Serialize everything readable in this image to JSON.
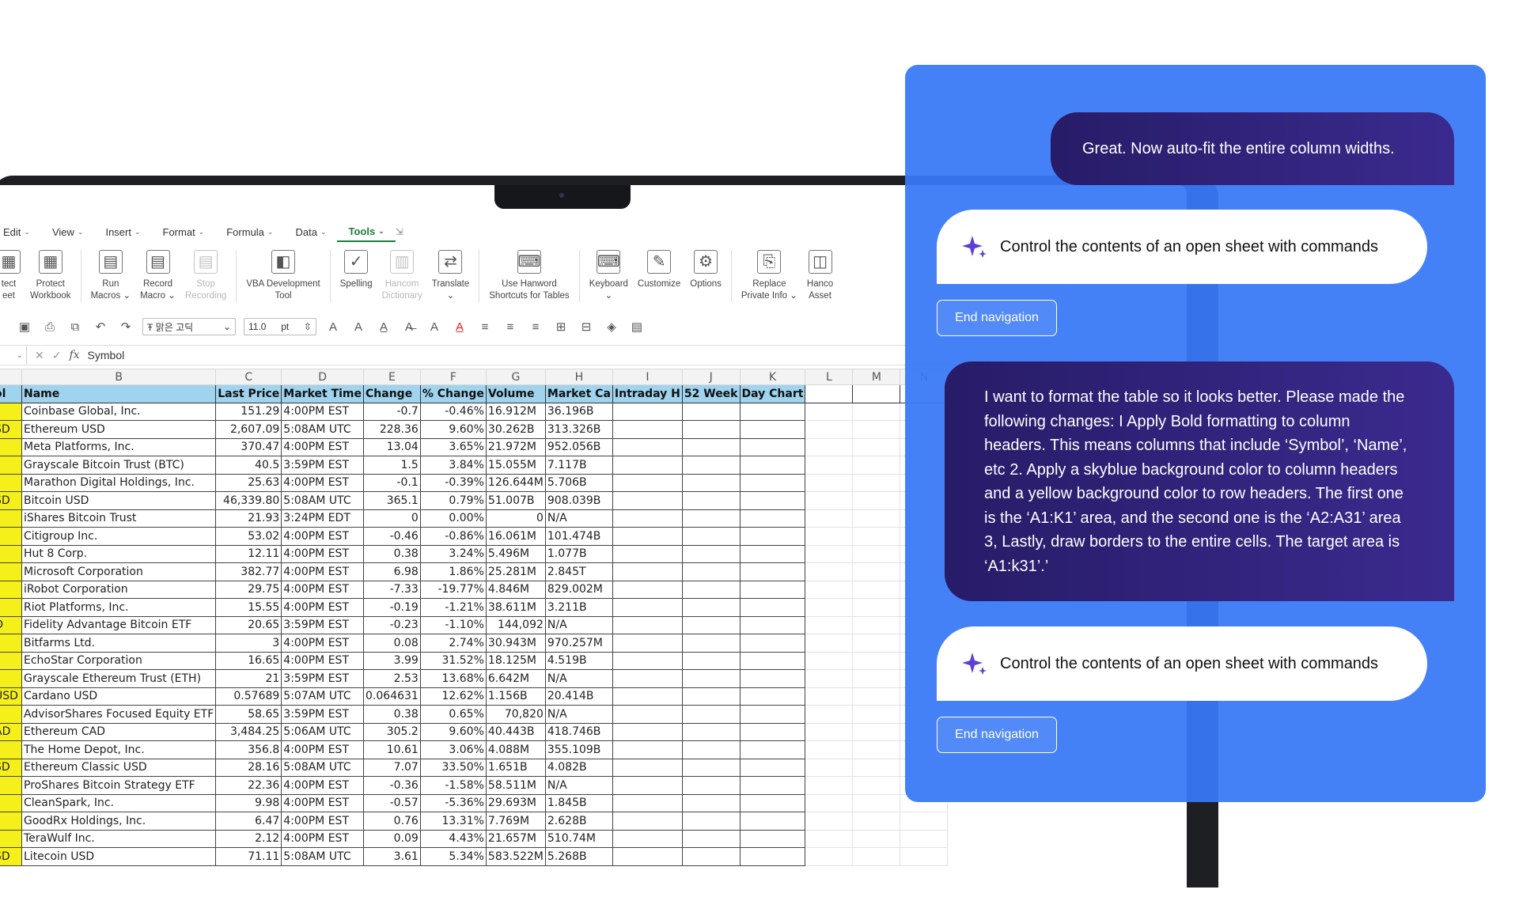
{
  "menu": {
    "items": [
      {
        "label": "Edit"
      },
      {
        "label": "View"
      },
      {
        "label": "Insert"
      },
      {
        "label": "Format"
      },
      {
        "label": "Formula"
      },
      {
        "label": "Data"
      },
      {
        "label": "Tools",
        "active": true
      }
    ]
  },
  "ribbon": {
    "items": [
      {
        "label": "tect\neet",
        "icon": "protect-sheet-icon",
        "disabled": false
      },
      {
        "label": "Protect\nWorkbook",
        "icon": "protect-workbook-icon",
        "disabled": false
      },
      {
        "label": "Run\nMacros ⌄",
        "icon": "run-macros-icon",
        "disabled": false
      },
      {
        "label": "Record\nMacro ⌄",
        "icon": "record-macro-icon",
        "disabled": false
      },
      {
        "label": "Stop\nRecording",
        "icon": "stop-recording-icon",
        "disabled": true
      },
      {
        "label": "VBA Development\nTool",
        "icon": "vba-tool-icon",
        "disabled": false
      },
      {
        "label": "Spelling",
        "icon": "spelling-icon",
        "disabled": false
      },
      {
        "label": "Hancom\nDictionary",
        "icon": "dictionary-icon",
        "disabled": true
      },
      {
        "label": "Translate\n⌄",
        "icon": "translate-icon",
        "disabled": false
      },
      {
        "label": "Use Hanword\nShortcuts for Tables",
        "icon": "hanword-shortcuts-icon",
        "disabled": false
      },
      {
        "label": "Keyboard\n⌄",
        "icon": "keyboard-icon",
        "disabled": false
      },
      {
        "label": "Customize",
        "icon": "customize-icon",
        "disabled": false
      },
      {
        "label": "Options",
        "icon": "options-gear-icon",
        "disabled": false
      },
      {
        "label": "Replace\nPrivate Info ⌄",
        "icon": "replace-private-info-icon",
        "disabled": false
      },
      {
        "label": "Hanco\nAsset",
        "icon": "hancom-asset-icon",
        "disabled": false
      }
    ]
  },
  "format_toolbar": {
    "font": "Ŧ 맑은 고딕",
    "size": "11.0",
    "size_unit": "pt"
  },
  "formula_bar": {
    "cell_value": "Symbol",
    "fx_label": "fx"
  },
  "sheet": {
    "column_letters": [
      "",
      "B",
      "C",
      "D",
      "E",
      "F",
      "G",
      "H",
      "I",
      "J",
      "K",
      "L",
      "M",
      "N"
    ],
    "header_row": [
      "ol",
      "Name",
      "Last Price",
      "Market Time",
      "Change",
      "% Change",
      "Volume",
      "Market Ca",
      "Intraday H",
      "52 Week",
      "Day Chart"
    ],
    "rows": [
      [
        "",
        "Coinbase Global, Inc.",
        "151.29",
        "4:00PM EST",
        "-0.7",
        "-0.46%",
        "16.912M",
        "36.196B"
      ],
      [
        "SD",
        "Ethereum USD",
        "2,607.09",
        "5:08AM UTC",
        "228.36",
        "9.60%",
        "30.262B",
        "313.326B"
      ],
      [
        "",
        "Meta Platforms, Inc.",
        "370.47",
        "4:00PM EST",
        "13.04",
        "3.65%",
        "21.972M",
        "952.056B"
      ],
      [
        "",
        "Grayscale Bitcoin Trust (BTC)",
        "40.5",
        "3:59PM EST",
        "1.5",
        "3.84%",
        "15.055M",
        "7.117B"
      ],
      [
        "",
        "Marathon Digital Holdings, Inc.",
        "25.63",
        "4:00PM EST",
        "-0.1",
        "-0.39%",
        "126.644M",
        "5.706B"
      ],
      [
        "SD",
        "Bitcoin USD",
        "46,339.80",
        "5:08AM UTC",
        "365.1",
        "0.79%",
        "51.007B",
        "908.039B"
      ],
      [
        "",
        "iShares Bitcoin Trust",
        "21.93",
        "3:24PM EDT",
        "0",
        "0.00%",
        "0",
        "N/A"
      ],
      [
        "",
        "Citigroup Inc.",
        "53.02",
        "4:00PM EST",
        "-0.46",
        "-0.86%",
        "16.061M",
        "101.474B"
      ],
      [
        "",
        "Hut 8 Corp.",
        "12.11",
        "4:00PM EST",
        "0.38",
        "3.24%",
        "5.496M",
        "1.077B"
      ],
      [
        "",
        "Microsoft Corporation",
        "382.77",
        "4:00PM EST",
        "6.98",
        "1.86%",
        "25.281M",
        "2.845T"
      ],
      [
        "",
        "iRobot Corporation",
        "29.75",
        "4:00PM EST",
        "-7.33",
        "-19.77%",
        "4.846M",
        "829.002M"
      ],
      [
        "",
        "Riot Platforms, Inc.",
        "15.55",
        "4:00PM EST",
        "-0.19",
        "-1.21%",
        "38.611M",
        "3.211B"
      ],
      [
        "O",
        "Fidelity Advantage Bitcoin ETF",
        "20.65",
        "3:59PM EST",
        "-0.23",
        "-1.10%",
        "144,092",
        "N/A"
      ],
      [
        "",
        "Bitfarms Ltd.",
        "3",
        "4:00PM EST",
        "0.08",
        "2.74%",
        "30.943M",
        "970.257M"
      ],
      [
        "",
        "EchoStar Corporation",
        "16.65",
        "4:00PM EST",
        "3.99",
        "31.52%",
        "18.125M",
        "4.519B"
      ],
      [
        "",
        "Grayscale Ethereum Trust (ETH)",
        "21",
        "3:59PM EST",
        "2.53",
        "13.68%",
        "6.642M",
        "N/A"
      ],
      [
        "USD",
        "Cardano USD",
        "0.57689",
        "5:07AM UTC",
        "0.064631",
        "12.62%",
        "1.156B",
        "20.414B"
      ],
      [
        "",
        "AdvisorShares Focused Equity ETF",
        "58.65",
        "3:59PM EST",
        "0.38",
        "0.65%",
        "70,820",
        "N/A"
      ],
      [
        "AD",
        "Ethereum CAD",
        "3,484.25",
        "5:06AM UTC",
        "305.2",
        "9.60%",
        "40.443B",
        "418.746B"
      ],
      [
        "",
        "The Home Depot, Inc.",
        "356.8",
        "4:00PM EST",
        "10.61",
        "3.06%",
        "4.088M",
        "355.109B"
      ],
      [
        "SD",
        "Ethereum Classic USD",
        "28.16",
        "5:08AM UTC",
        "7.07",
        "33.50%",
        "1.651B",
        "4.082B"
      ],
      [
        "",
        "ProShares Bitcoin Strategy ETF",
        "22.36",
        "4:00PM EST",
        "-0.36",
        "-1.58%",
        "58.511M",
        "N/A"
      ],
      [
        "",
        "CleanSpark, Inc.",
        "9.98",
        "4:00PM EST",
        "-0.57",
        "-5.36%",
        "29.693M",
        "1.845B"
      ],
      [
        "",
        "GoodRx Holdings, Inc.",
        "6.47",
        "4:00PM EST",
        "0.76",
        "13.31%",
        "7.769M",
        "2.628B"
      ],
      [
        "",
        "TeraWulf Inc.",
        "2.12",
        "4:00PM EST",
        "0.09",
        "4.43%",
        "21.657M",
        "510.74M"
      ],
      [
        "SD",
        "Litecoin USD",
        "71.11",
        "5:08AM UTC",
        "3.61",
        "5.34%",
        "583.522M",
        "5.268B"
      ]
    ]
  },
  "chat": {
    "messages": [
      {
        "role": "user",
        "text": "Great. Now auto-fit the entire column widths."
      },
      {
        "role": "assistant",
        "text": "Control the contents of an open sheet with commands",
        "button": "End navigation"
      },
      {
        "role": "user",
        "text": "I want to format the table so it looks better. Please made the following changes: I Apply Bold formatting to column headers. This means columns that include ‘Symbol’, ‘Name’, etc 2. Apply a skyblue background color to column headers and a yellow background color to row headers. The first one is the ‘A1:K1’ area, and the second one is the ‘A2:A31’ area 3, Lastly, draw borders to the entire cells. The target area is ‘A1:k31’.’"
      },
      {
        "role": "assistant",
        "text": "Control the contents of an open sheet with commands",
        "button": "End navigation"
      }
    ]
  },
  "colors": {
    "panel": "#3879f6",
    "user_bubble": "#2f2278",
    "header_fill": "#9fd3ee",
    "row_header_fill": "#f5f01a",
    "active_tab": "#1a7d3c"
  }
}
